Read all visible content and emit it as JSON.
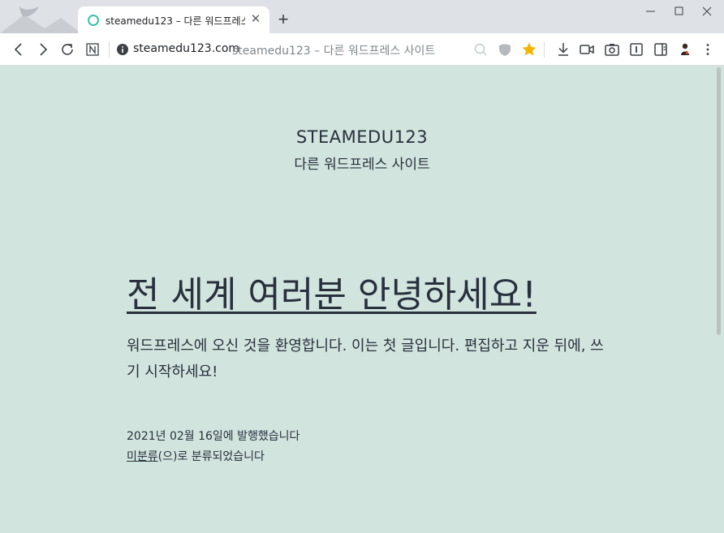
{
  "browser": {
    "tab_title": "steamedu123 – 다른 워드프레스 사이트",
    "close_glyph": "✕",
    "new_tab_glyph": "+",
    "address_domain": "steamedu123.com",
    "address_title": "steamedu123 – 다른 워드프레스 사이트",
    "bookmark_color": "#f4b400",
    "accent_color": "#3cc0a8",
    "icons": [
      "back-icon",
      "forward-icon",
      "reload-icon",
      "notion-icon",
      "info-icon",
      "zoom-icon",
      "shield-icon",
      "bookmark-star-icon",
      "download-icon",
      "video-icon",
      "camera-icon",
      "reader-icon",
      "sidebar-icon",
      "profile-icon",
      "menu-icon"
    ]
  },
  "site": {
    "title": "STEAMEDU123",
    "description": "다른 워드프레스 사이트",
    "background_color": "#d1e4dd",
    "text_color": "#28303d"
  },
  "post": {
    "title": "전 세계 여러분 안녕하세요!",
    "body": "워드프레스에 오신 것을 환영합니다. 이는 첫 글입니다. 편집하고 지운 뒤에, 쓰기 시작하세요!",
    "date_text": "2021년 02월 16일에 발행했습니다",
    "category_link": "미분류",
    "category_suffix": "(으)로 분류되었습니다"
  }
}
